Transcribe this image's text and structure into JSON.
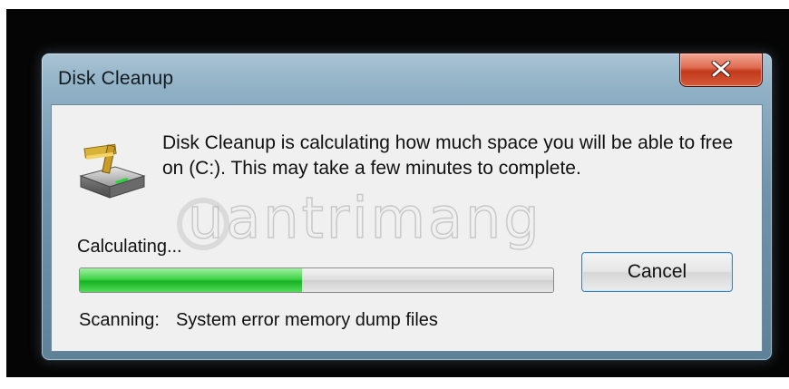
{
  "window": {
    "title": "Disk Cleanup",
    "close_icon": "close-x-icon"
  },
  "content": {
    "icon": "disk-cleanup-drive-icon",
    "message": "Disk Cleanup is calculating how much space you will be able to free on  (C:). This may take a few minutes to complete.",
    "status_label": "Calculating...",
    "progress_fraction": 0.47,
    "progress_color": "#2ec338",
    "scan_label": "Scanning:",
    "scan_item": "System error memory dump files"
  },
  "buttons": {
    "cancel_label": "Cancel"
  },
  "watermark": {
    "text": "uantrimang"
  }
}
